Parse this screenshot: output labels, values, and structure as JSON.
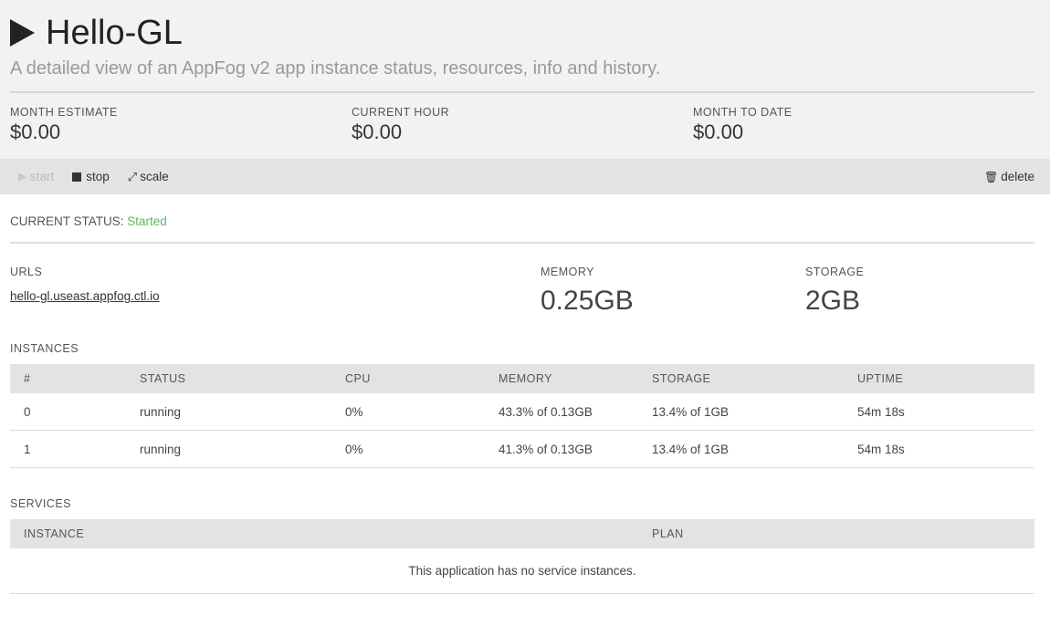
{
  "app": {
    "title": "Hello-GL",
    "subtitle": "A detailed view of an AppFog v2 app instance status, resources, info and history."
  },
  "costs": [
    {
      "label": "MONTH ESTIMATE",
      "value": "$0.00"
    },
    {
      "label": "CURRENT HOUR",
      "value": "$0.00"
    },
    {
      "label": "MONTH TO DATE",
      "value": "$0.00"
    }
  ],
  "toolbar": {
    "start_label": "start",
    "stop_label": "stop",
    "scale_label": "scale",
    "delete_label": "delete"
  },
  "status": {
    "label": "CURRENT STATUS:",
    "value": "Started",
    "color": "#5cb85c"
  },
  "urls": {
    "label": "URLS",
    "url": "hello-gl.useast.appfog.ctl.io"
  },
  "memory": {
    "label": "MEMORY",
    "value": "0.25GB"
  },
  "storage": {
    "label": "STORAGE",
    "value": "2GB"
  },
  "instances": {
    "label": "INSTANCES",
    "columns": [
      "#",
      "STATUS",
      "CPU",
      "MEMORY",
      "STORAGE",
      "UPTIME"
    ],
    "rows": [
      [
        "0",
        "running",
        "0%",
        "43.3% of 0.13GB",
        "13.4% of 1GB",
        "54m 18s"
      ],
      [
        "1",
        "running",
        "0%",
        "41.3% of 0.13GB",
        "13.4% of 1GB",
        "54m 18s"
      ]
    ]
  },
  "services": {
    "label": "SERVICES",
    "columns": [
      "INSTANCE",
      "PLAN"
    ],
    "empty_message": "This application has no service instances."
  }
}
